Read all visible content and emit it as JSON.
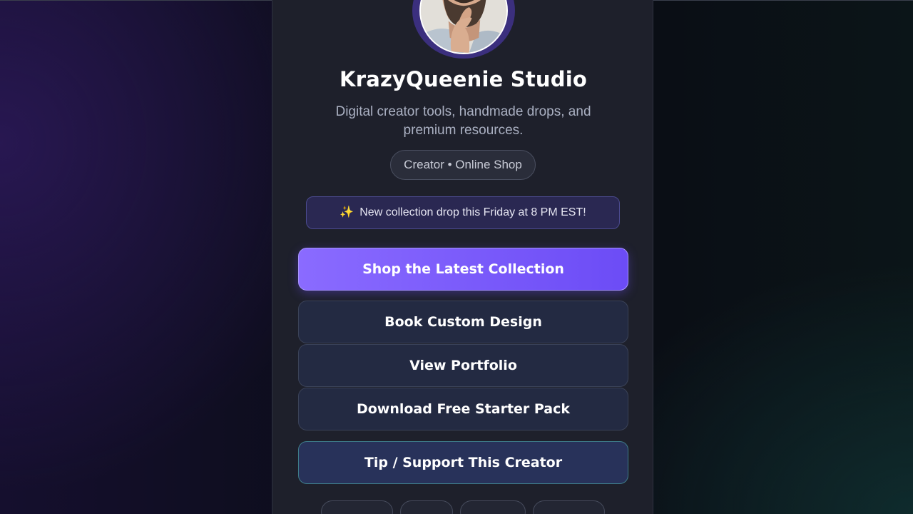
{
  "profile": {
    "name": "KrazyQueenie Studio",
    "bio": "Digital creator tools, handmade drops, and premium resources.",
    "category": "Creator • Online Shop"
  },
  "announcement": {
    "icon": "sparkles-icon",
    "text": "New collection drop this Friday at 8 PM EST!"
  },
  "links": {
    "primary": "Shop the Latest Collection",
    "items": [
      "Book Custom Design",
      "View Portfolio",
      "Download Free Starter Pack"
    ],
    "tip": "Tip / Support This Creator"
  },
  "colors": {
    "accent": "#7b5cff",
    "background": "#0d0d1c",
    "panel": "#1e202b"
  }
}
